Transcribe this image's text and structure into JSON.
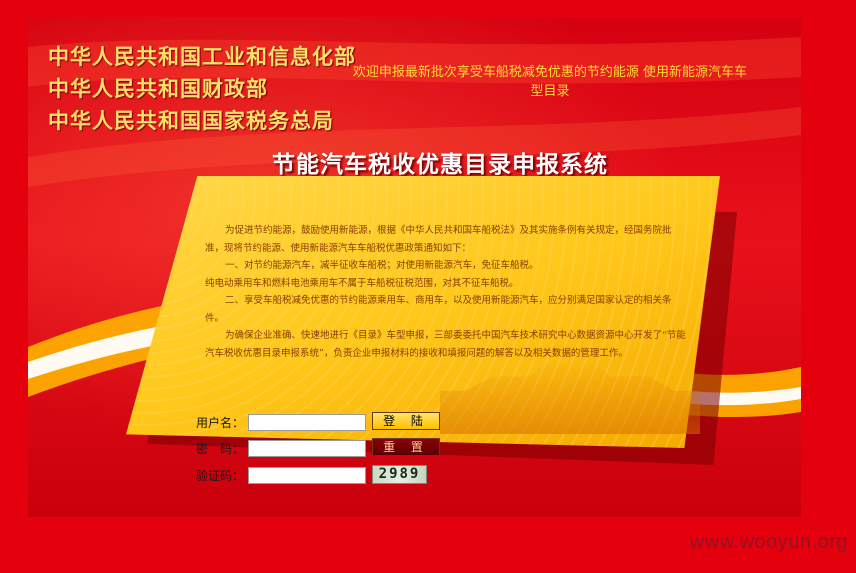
{
  "header": {
    "orgs": [
      "中华人民共和国工业和信息化部",
      "中华人民共和国财政部",
      "中华人民共和国国家税务总局"
    ],
    "welcome": "欢迎申报最新批次享受车船税减免优惠的节约能源 使用新能源汽车车型目录",
    "system_title": "节能汽车税收优惠目录申报系统"
  },
  "notice": {
    "paragraphs": [
      "为促进节约能源，鼓励使用新能源，根据《中华人民共和国车船税法》及其实施条例有关规定，经国务院批准，现将节约能源、使用新能源汽车车船税优惠政策通知如下：",
      "一、对节约能源汽车，减半征收车船税；对使用新能源汽车，免征车船税。",
      "纯电动乘用车和燃料电池乘用车不属于车船税征税范围，对其不征车船税。",
      "二、享受车船税减免优惠的节约能源乘用车、商用车，以及使用新能源汽车，应分别满足国家认定的相关条件。",
      "为确保企业准确、快速地进行《目录》车型申报，三部委委托中国汽车技术研究中心数据资源中心开发了“节能汽车税收优惠目录申报系统”，负责企业申报材料的接收和填报问题的解答以及相关数据的管理工作。"
    ]
  },
  "form": {
    "username_label": "用户名：",
    "password_label": "密　码：",
    "captcha_label": "验证码：",
    "login_label": "登 陆",
    "reset_label": "重 置",
    "captcha_value": "2989"
  },
  "watermark": "www.wooyun.org",
  "colors": {
    "background": "#e4000c",
    "header_text": "#ffe06a",
    "panel": "#ffc81a"
  }
}
